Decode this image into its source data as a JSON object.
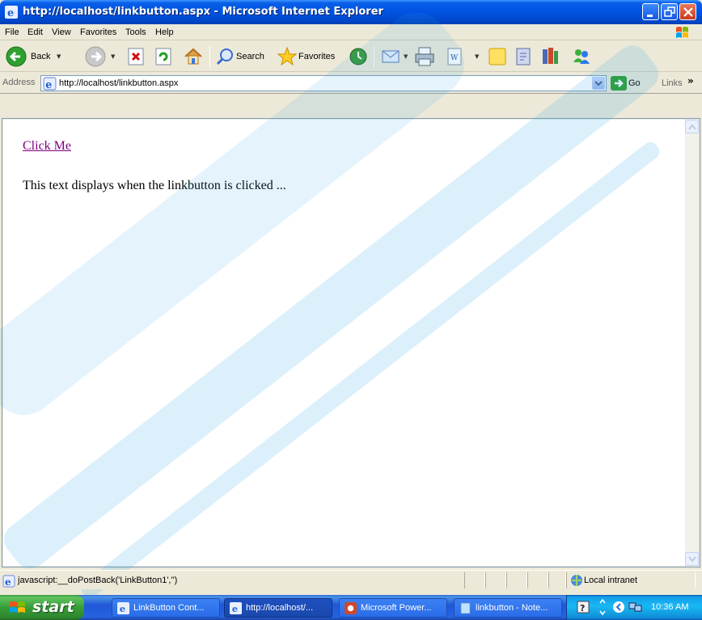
{
  "window": {
    "title": "http://localhost/linkbutton.aspx - Microsoft Internet Explorer"
  },
  "menu": {
    "items": [
      "File",
      "Edit",
      "View",
      "Favorites",
      "Tools",
      "Help"
    ]
  },
  "toolbar": {
    "back_label": "Back",
    "search_label": "Search",
    "favorites_label": "Favorites"
  },
  "address": {
    "label": "Address",
    "url": "http://localhost/linkbutton.aspx",
    "go_label": "Go",
    "links_label": "Links",
    "links_chevron": "»"
  },
  "page": {
    "link_text": "Click Me",
    "body_text": "This text displays when the linkbutton is clicked ..."
  },
  "statusbar": {
    "text": "javascript:__doPostBack('LinkButton1','')",
    "zone": "Local intranet"
  },
  "taskbar": {
    "start_label": "start",
    "tasks": [
      {
        "label": "LinkButton Cont...",
        "icon": "ie-icon"
      },
      {
        "label": "http://localhost/...",
        "icon": "ie-icon"
      },
      {
        "label": "Microsoft Power...",
        "icon": "powerpoint-icon"
      },
      {
        "label": "linkbutton - Note...",
        "icon": "notepad-icon"
      }
    ],
    "clock": "10:36 AM"
  },
  "colors": {
    "titlebar": "#0054e3",
    "visited_link": "#800080",
    "taskbar": "#2157d7",
    "start_button": "#379d37"
  }
}
